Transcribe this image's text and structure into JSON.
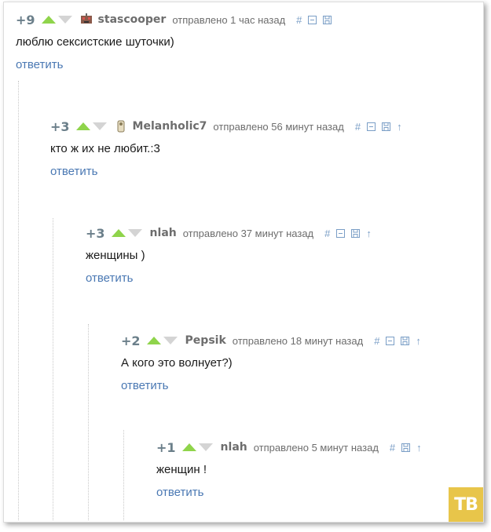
{
  "comments": [
    {
      "score": "+9",
      "user": "stascooper",
      "posted": "отправлено 1 час назад",
      "text": "люблю сексистские шуточки)",
      "reply": "ответить",
      "avatar": "robot-avatar-icon",
      "has_parent_link": false
    },
    {
      "score": "+3",
      "user": "Melanholic7",
      "posted": "отправлено 56 минут назад",
      "text": "кто ж их не любит.:3",
      "reply": "ответить",
      "avatar": "figure-avatar-icon",
      "has_parent_link": true
    },
    {
      "score": "+3",
      "user": "nlah",
      "posted": "отправлено 37 минут назад",
      "text": "женщины )",
      "reply": "ответить",
      "has_parent_link": true
    },
    {
      "score": "+2",
      "user": "Pepsik",
      "posted": "отправлено 18 минут назад",
      "text": "А кого это волнует?)",
      "reply": "ответить",
      "has_parent_link": true
    },
    {
      "score": "+1",
      "user": "nlah",
      "posted": "отправлено 5 минут назад",
      "text": "женщин !",
      "reply": "ответить",
      "has_parent_link": true,
      "no_collapse": true
    }
  ],
  "icons": {
    "link": "#",
    "collapse": "collapse-icon",
    "save": "save-icon",
    "parent": "↑"
  },
  "watermark": {
    "text": "ТВ",
    "color": "#e8c54a"
  },
  "colors": {
    "upvote": "#8fd44b",
    "downvote": "#d4d4d4",
    "link": "#4a78b3",
    "tool": "#7a9ec6"
  }
}
